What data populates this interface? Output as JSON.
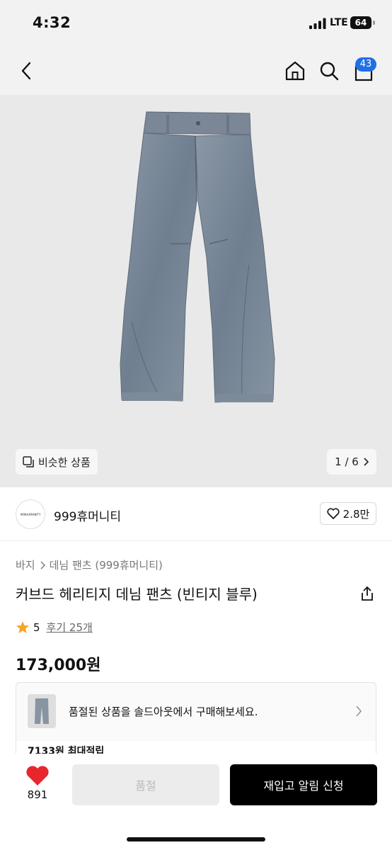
{
  "status": {
    "time": "4:32",
    "network": "LTE",
    "battery": "64"
  },
  "nav": {
    "cart_count": "43"
  },
  "gallery": {
    "similar_label": "비슷한 상품",
    "page_indicator": "1 / 6"
  },
  "brand": {
    "logo_text": "999HUMANITY",
    "name": "999휴머니티",
    "likes": "2.8만"
  },
  "breadcrumb": [
    "바지",
    "데님 팬츠 (999휴머니티)"
  ],
  "product": {
    "title": "커브드 헤리티지 데님 팬츠 (빈티지 블루)",
    "rating": "5",
    "reviews": "후기 25개",
    "price": "173,000원"
  },
  "soldout_notice": {
    "text": "품절된 상품을 솔드아웃에서 구매해보세요."
  },
  "points": {
    "text": "7133원 최대적립"
  },
  "bottom": {
    "like_count": "891",
    "soldout_label": "품절",
    "restock_label": "재입고 알림 신청"
  },
  "colors": {
    "accent": "#1f6fe5",
    "heart": "#e8262e",
    "star": "#f5a623"
  }
}
